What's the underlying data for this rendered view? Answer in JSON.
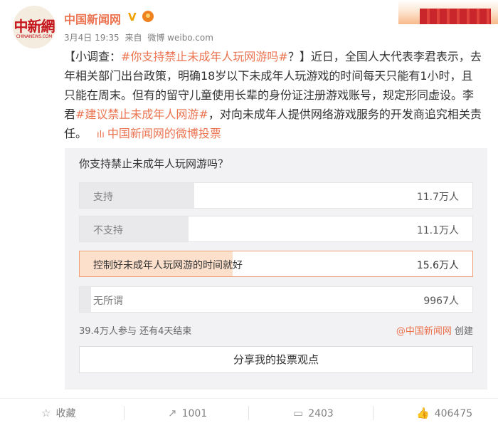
{
  "avatar": {
    "logo_text": "中新網",
    "logo_sub": "CHINANEWS.COM"
  },
  "user": {
    "name": "中国新闻网"
  },
  "meta": {
    "date": "3月4日 19:35",
    "from_label": "来自",
    "source": "微博 weibo.com"
  },
  "post": {
    "bracket_open": "【小调查：",
    "tag1": "#你支持禁止未成年人玩网游吗#",
    "seg1": "？】近日，全国人大代表李君表示，去年相关部门出台政策，明确18岁以下未成年人玩游戏的时间每天只能有1小时，且只能在周末。但有的留守儿童使用长辈的身份证注册游戏账号，规定形同虚设。李君",
    "tag2": "#建议禁止未成年人网游#",
    "seg2": "，对向未成年人提供网络游戏服务的开发商追究相关责任。",
    "link_icon": "poll-chart-icon",
    "link_text": "中国新闻网的微博投票"
  },
  "vote": {
    "question": "你支持禁止未成年人玩网游吗？",
    "options": [
      {
        "label": "支持",
        "count": "11.7万人",
        "share": 0.297
      },
      {
        "label": "不支持",
        "count": "11.1万人",
        "share": 0.282
      },
      {
        "label": "控制好未成年人玩网游的时间就好",
        "count": "15.6万人",
        "share": 0.396,
        "selected": true
      },
      {
        "label": "无所谓",
        "count": "9967人",
        "share": 0.025
      }
    ],
    "status": "39.4万人参与 还有4天结束",
    "creator_link": "@中国新闻网",
    "creator_suffix": "创建",
    "share_label": "分享我的投票观点"
  },
  "actions": {
    "favorite": "收藏",
    "repost": "1001",
    "comment": "2403",
    "like": "406475"
  },
  "colors": {
    "accent": "#eb7350",
    "selected_border": "#f0a078",
    "selected_fill": "#fde0cc"
  }
}
